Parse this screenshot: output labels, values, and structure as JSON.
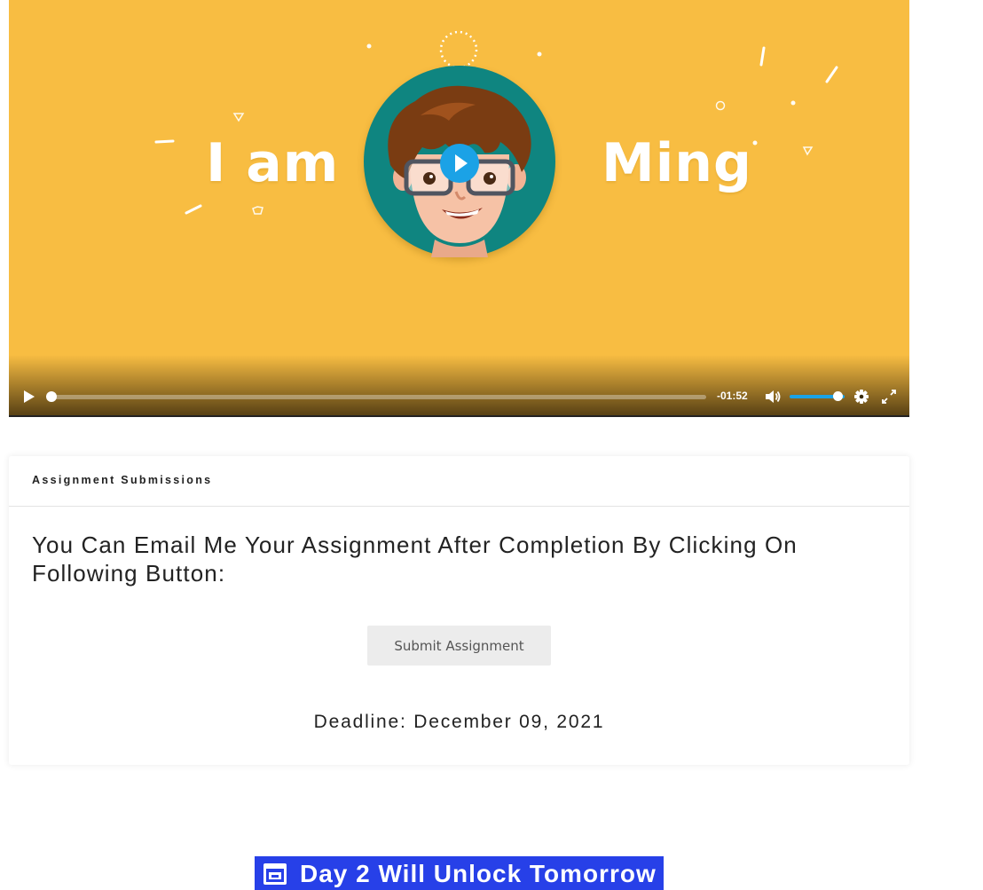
{
  "video": {
    "title_left": "I am",
    "title_right": "Ming",
    "controls": {
      "time_remaining": "-01:52",
      "progress": 0.0,
      "volume": 0.85
    },
    "colors": {
      "background": "#f8bd42",
      "accent": "#1ba2e6",
      "avatar_circle": "#0f8580"
    },
    "icons": [
      "play-icon",
      "volume-icon",
      "gear-icon",
      "fullscreen-icon"
    ]
  },
  "assignment": {
    "header": "Assignment Submissions",
    "instructions": "You Can Email Me Your Assignment After Completion By Clicking On Following Button:",
    "submit_label": "Submit Assignment",
    "deadline_label": "Deadline:",
    "deadline_date": "December 09, 2021"
  },
  "unlock_banner": {
    "label": "Day 2 Will Unlock Tomorrow",
    "icon": "window-icon",
    "color": "#2740e8"
  }
}
